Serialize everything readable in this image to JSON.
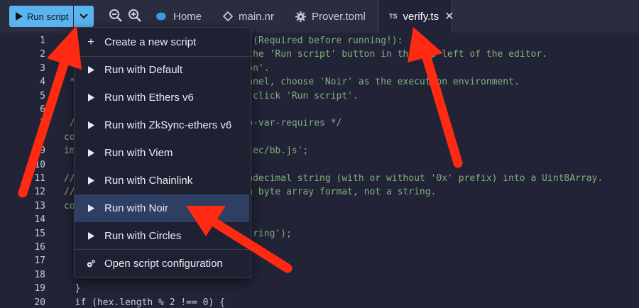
{
  "toolbar": {
    "run_script_label": "Run script",
    "tabs": [
      {
        "label": "Home",
        "icon": "remix-logo-icon"
      },
      {
        "label": "main.nr",
        "icon": "noir-diamond-icon"
      },
      {
        "label": "Prover.toml",
        "icon": "gear-icon"
      },
      {
        "label": "verify.ts",
        "badge": "TS",
        "icon": "close-icon"
      }
    ]
  },
  "editor": {
    "line_numbers": [
      "1",
      "2",
      "3",
      "4",
      "5",
      "6",
      "7",
      "8",
      "9",
      "10",
      "11",
      "12",
      "13",
      "14",
      "15",
      "16",
      "17",
      "18",
      "19",
      "20"
    ],
    "lines": [
      "/*                            ion (Required before running!):",
      "                              to the 'Run script' button in the top left of the editor.",
      "                              ation'.",
      " *                            r panel, choose 'Noir' as the execution environment.",
      "  *                           hen click 'Run script'.",
      "  *",
      " /*                           t/no-var-requires */",
      "co",
      "im                            maztec/bb.js';",
      "",
      "//                            hexadecimal string (with or without '0x' prefix) into a Uint8Array.",
      "//                            in a byte array format, not a string.",
      "co",
      "",
      "                              a string');",
      "",
      "",
      "",
      "  }",
      "  if (hex.length % 2 !== 0) {"
    ]
  },
  "menu": {
    "create_label": "Create a new script",
    "items": [
      "Run with Default",
      "Run with Ethers v6",
      "Run with ZkSync-ethers v6",
      "Run with Viem",
      "Run with Chainlink",
      "Run with Noir",
      "Run with Circles"
    ],
    "config_label": "Open script configuration"
  },
  "colors": {
    "accent": "#5ab4f0",
    "arrow": "#ff2a12",
    "highlight": "#2f3f63"
  }
}
